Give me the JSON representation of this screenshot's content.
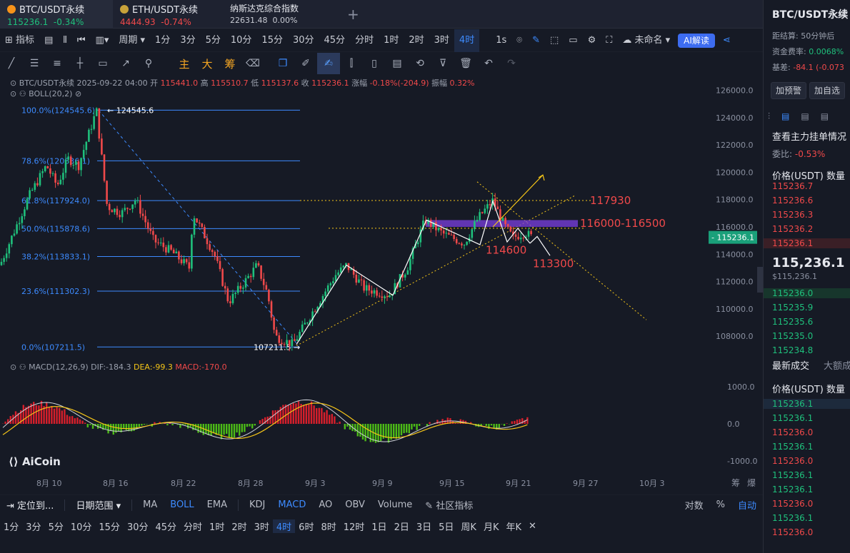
{
  "tabs": [
    {
      "name": "BTC/USDT永续",
      "price": "115236.1",
      "change": "-0.34%",
      "color": "#f7931a"
    },
    {
      "name": "ETH/USDT永续",
      "price": "4444.93",
      "change": "-0.74%",
      "color": "#c8a23a"
    },
    {
      "name": "纳斯达克综合指数",
      "price": "22631.48",
      "change": "0.00%"
    }
  ],
  "add_tab": "+",
  "toolbar": {
    "indicator_label": "指标",
    "period_label": "周期",
    "intervals": [
      "1分",
      "3分",
      "5分",
      "10分",
      "15分",
      "30分",
      "45分",
      "分时",
      "1时",
      "2时",
      "3时",
      "4时"
    ],
    "active_interval": "4时",
    "second": "1s",
    "unnamed": "未命名",
    "ai_label": "AI解读"
  },
  "draw_tools": {
    "zhu": "主",
    "da": "大",
    "chou": "筹"
  },
  "ohlc_line": {
    "symbol": "BTC/USDT永续",
    "time": "2025-09-22 04:00",
    "open_label": "开",
    "open": "115441.0",
    "high_label": "高",
    "high": "115510.7",
    "low_label": "低",
    "low": "115137.6",
    "close_label": "收",
    "close": "115236.1",
    "chg_label": "涨幅",
    "chg": "-0.18%(-204.9)",
    "amp_label": "振幅",
    "amp": "0.32%"
  },
  "boll_label": "BOLL(20,2)",
  "macd_line": {
    "name": "MACD(12,26,9)",
    "dif": "DIF:-184.3",
    "dea": "DEA:-99.3",
    "macd": "MACD:-170.0"
  },
  "fib": [
    {
      "label": "100.0%(124545.6)",
      "value": 124545.6
    },
    {
      "label": "78.6%(120836.1)",
      "value": 120836.1
    },
    {
      "label": "61.8%(117924.0)",
      "value": 117924.0
    },
    {
      "label": "50.0%(115878.6)",
      "value": 115878.6
    },
    {
      "label": "38.2%(113833.1)",
      "value": 113833.1
    },
    {
      "label": "23.6%(111302.3)",
      "value": 111302.3
    },
    {
      "label": "0.0%(107211.5)",
      "value": 107211.5
    }
  ],
  "high_mark": "124545.6",
  "low_mark": "107211.5",
  "annotations": {
    "a1": "117930",
    "a2": "116000-116500",
    "a3": "114600",
    "a4": "113300"
  },
  "price_axis": [
    "126000.0",
    "124000.0",
    "122000.0",
    "120000.0",
    "118000.0",
    "116000.0",
    "114000.0",
    "112000.0",
    "110000.0",
    "108000.0"
  ],
  "current_price": "115236.1",
  "macd_axis": [
    "1000.0",
    "0.0",
    "-1000.0"
  ],
  "time_axis": [
    "8月 10",
    "8月 16",
    "8月 22",
    "8月 28",
    "9月 3",
    "9月 9",
    "9月 15",
    "9月 21",
    "9月 27",
    "10月 3"
  ],
  "time_axis_right": [
    "筹",
    "爆"
  ],
  "logo": "AiCoin",
  "bottom1": {
    "locate": "定位到...",
    "range": "日期范围",
    "indicators": [
      "MA",
      "BOLL",
      "EMA",
      "KDJ",
      "MACD",
      "AO",
      "OBV",
      "Volume"
    ],
    "active": [
      "BOLL",
      "MACD"
    ],
    "community": "社区指标",
    "log": "对数",
    "pct": "%",
    "auto": "自动"
  },
  "bottom2": {
    "intervals": [
      "1分",
      "3分",
      "5分",
      "10分",
      "15分",
      "30分",
      "45分",
      "分时",
      "1时",
      "2时",
      "3时",
      "4时",
      "6时",
      "8时",
      "12时",
      "1日",
      "2日",
      "3日",
      "5日",
      "周K",
      "月K",
      "年K"
    ],
    "active": "4时",
    "close": "✕"
  },
  "right_panel": {
    "title": "BTC/USDT永续",
    "settle": "距结算: 50分钟后",
    "funding_label": "资金费率:",
    "funding": "0.0068%",
    "basis_label": "基差:",
    "basis": "-84.1 (-0.073",
    "btn_alert": "加预警",
    "btn_fav": "加自选",
    "depth_title": "查看主力挂单情况",
    "ratio_label": "委比:",
    "ratio": "-0.53%",
    "col_price": "价格(USDT)",
    "col_qty": "数量",
    "asks": [
      "115236.7",
      "115236.6",
      "115236.3",
      "115236.2",
      "115236.1"
    ],
    "mid_price": "115,236.1",
    "mid_sub": "$115,236.1",
    "bids": [
      "115236.0",
      "115235.9",
      "115235.6",
      "115235.0",
      "115234.8"
    ],
    "trades_tab": "最新成交",
    "trades_tab2": "大额成",
    "trades": [
      {
        "p": "115236.1",
        "c": "g"
      },
      {
        "p": "115236.1",
        "c": "g"
      },
      {
        "p": "115236.0",
        "c": "r"
      },
      {
        "p": "115236.1",
        "c": "g"
      },
      {
        "p": "115236.0",
        "c": "r"
      },
      {
        "p": "115236.1",
        "c": "g"
      },
      {
        "p": "115236.1",
        "c": "g"
      },
      {
        "p": "115236.0",
        "c": "r"
      },
      {
        "p": "115236.1",
        "c": "g"
      },
      {
        "p": "115236.0",
        "c": "r"
      }
    ]
  },
  "colors": {
    "up": "#1fc07c",
    "down": "#f0494a",
    "accent": "#3d8bff",
    "fib": "#3d8bff",
    "boll_mid": "#f5c518"
  }
}
